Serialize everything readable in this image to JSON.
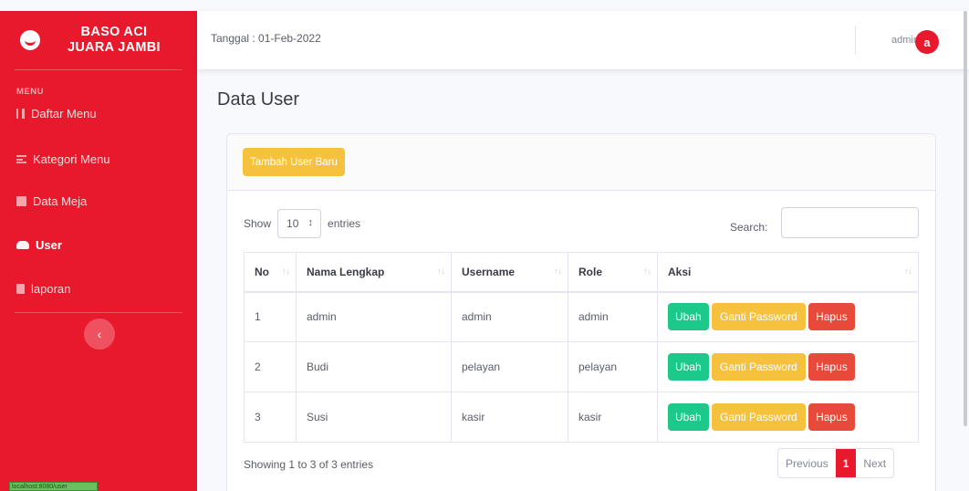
{
  "brand": {
    "line1": "BASO ACI",
    "line2": "JUARA JAMBI"
  },
  "sidebar": {
    "heading": "MENU",
    "items": [
      {
        "label": "Daftar Menu",
        "icon": "utensils-icon"
      },
      {
        "label": "Kategori Menu",
        "icon": "list-icon"
      },
      {
        "label": "Data Meja",
        "icon": "table-icon"
      },
      {
        "label": "User",
        "icon": "users-icon",
        "active": true
      },
      {
        "label": "laporan",
        "icon": "file-icon"
      }
    ],
    "toggle": "‹",
    "status_url": "localhost:8080/user"
  },
  "topbar": {
    "date": "Tanggal : 01-Feb-2022",
    "user": "admin",
    "avatar": "a"
  },
  "page": {
    "title": "Data User"
  },
  "card": {
    "add_button": "Tambah User Baru",
    "show_label": "Show",
    "entries_value": "10",
    "entries_label": "entries",
    "search_label": "Search:",
    "columns": [
      "No",
      "Nama Lengkap",
      "Username",
      "Role",
      "Aksi"
    ],
    "rows": [
      {
        "no": "1",
        "nama": "admin",
        "username": "admin",
        "role": "admin"
      },
      {
        "no": "2",
        "nama": "Budi",
        "username": "pelayan",
        "role": "pelayan"
      },
      {
        "no": "3",
        "nama": "Susi",
        "username": "kasir",
        "role": "kasir"
      }
    ],
    "actions": {
      "edit": "Ubah",
      "password": "Ganti Password",
      "delete": "Hapus"
    },
    "info": "Showing 1 to 3 of 3 entries",
    "pagination": {
      "previous": "Previous",
      "current": "1",
      "next": "Next"
    }
  },
  "colors": {
    "brand": "#e8192c",
    "warning": "#f6c23e",
    "success": "#1cc88a",
    "danger": "#e74a3b"
  }
}
